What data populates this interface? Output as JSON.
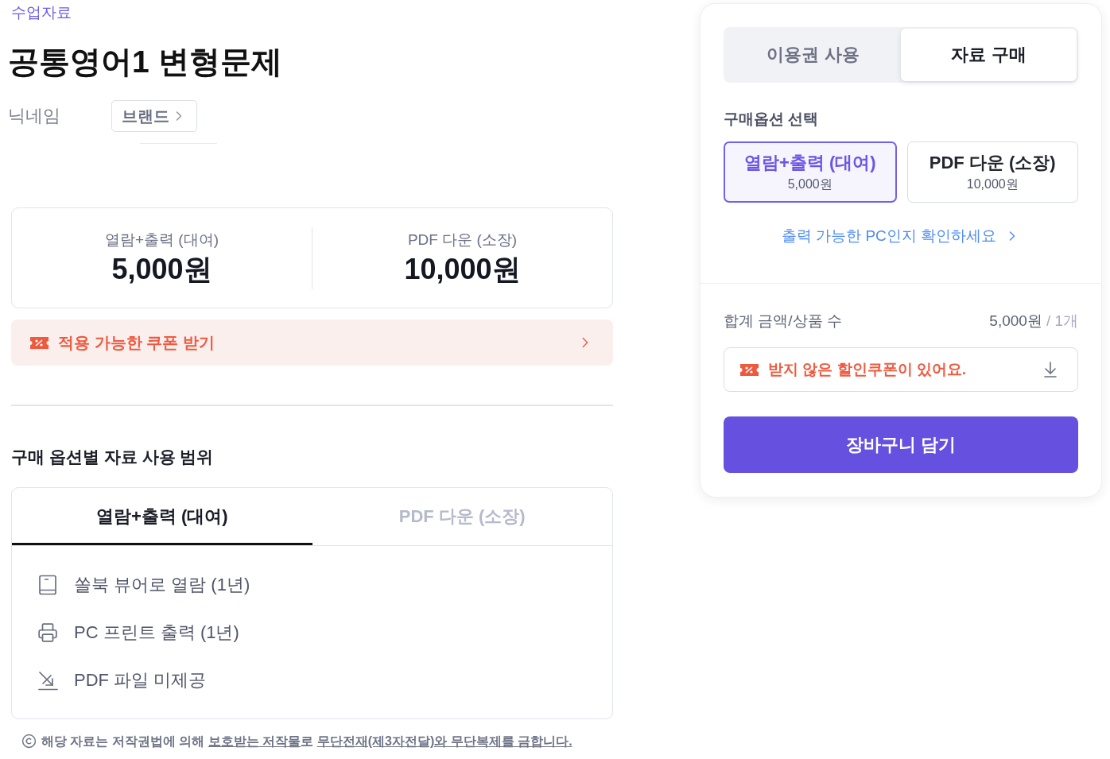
{
  "breadcrumb": "수업자료",
  "title": "공통영어1 변형문제",
  "author": {
    "nickname": "닉네임",
    "brand_button": "브랜드"
  },
  "price_card": {
    "options": [
      {
        "label": "열람+출력 (대여)",
        "price": "5,000원"
      },
      {
        "label": "PDF 다운 (소장)",
        "price": "10,000원"
      }
    ]
  },
  "coupon_banner": {
    "text": "적용 가능한 쿠폰 받기"
  },
  "usage_scope": {
    "heading": "구매 옵션별 자료 사용 범위",
    "tabs": [
      {
        "label": "열람+출력 (대여)",
        "selected": true
      },
      {
        "label": "PDF 다운 (소장)",
        "selected": false
      }
    ],
    "items": [
      {
        "kind": "viewer",
        "text": "쏠북 뷰어로 열람 (1년)"
      },
      {
        "kind": "print",
        "text": "PC 프린트 출력 (1년)"
      },
      {
        "kind": "no_download",
        "text": "PDF 파일 미제공"
      }
    ]
  },
  "notice": [
    {
      "kind": "plain",
      "text": "해당 자료는 저작권법에 의해 "
    },
    {
      "kind": "link",
      "text": "보호받는 저작물"
    },
    {
      "kind": "plain",
      "text": "로 "
    },
    {
      "kind": "link",
      "text": "무단전재(제3자전달)와 무단복제를 금합니다."
    }
  ],
  "purchase_panel": {
    "tabs": [
      {
        "label": "이용권 사용",
        "selected": false
      },
      {
        "label": "자료 구매",
        "selected": true
      }
    ],
    "option_heading": "구매옵션 선택",
    "options": [
      {
        "label": "열람+출력 (대여)",
        "price": "5,000원",
        "selected": true
      },
      {
        "label": "PDF 다운 (소장)",
        "price": "10,000원",
        "selected": false
      }
    ],
    "pc_check_link": "출력 가능한 PC인지 확인하세요",
    "total": {
      "label": "합계 금액/상품 수",
      "amount": "5,000원",
      "count": "/ 1개"
    },
    "coupon_field": {
      "text": "받지 않은 할인쿠폰이 있어요."
    },
    "cart_button": "장바구니 담기"
  }
}
